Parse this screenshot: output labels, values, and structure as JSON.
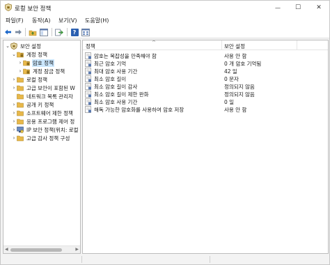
{
  "window": {
    "title": "로컬 보안 정책",
    "minimize_glyph": "—",
    "maximize_glyph": "☐",
    "close_glyph": "✕"
  },
  "menu": [
    {
      "label": "파일(F)"
    },
    {
      "label": "동작(A)"
    },
    {
      "label": "보기(V)"
    },
    {
      "label": "도움말(H)"
    }
  ],
  "toolbar": {
    "icons": [
      "back-arrow-icon",
      "forward-arrow-icon",
      "folder-up-icon",
      "show-hide-tree-icon",
      "export-list-icon",
      "help-icon",
      "properties-view-icon"
    ],
    "help_glyph": "?"
  },
  "tree": {
    "nodes": [
      {
        "label": "보안 설정",
        "expanded": true,
        "level": 0,
        "icon": "security-settings-icon"
      },
      {
        "label": "계정 정책",
        "expanded": true,
        "level": 1,
        "icon": "folder-icon"
      },
      {
        "label": "암호 정책",
        "expanded": false,
        "level": 2,
        "icon": "folder-icon",
        "selected": true
      },
      {
        "label": "계정 잠금 정책",
        "expanded": false,
        "level": 2,
        "icon": "folder-icon"
      },
      {
        "label": "로컬 정책",
        "expanded": false,
        "level": 1,
        "icon": "folder-icon"
      },
      {
        "label": "고급 보안이 포함된 W",
        "expanded": false,
        "level": 1,
        "icon": "folder-icon"
      },
      {
        "label": "네트워크 목록 관리자",
        "expanded": false,
        "level": 1,
        "icon": "folder-icon",
        "no_arrow": true
      },
      {
        "label": "공개 키 정책",
        "expanded": false,
        "level": 1,
        "icon": "folder-icon"
      },
      {
        "label": "소프트웨어 제한 정책",
        "expanded": false,
        "level": 1,
        "icon": "folder-icon"
      },
      {
        "label": "응용 프로그램 제어 정",
        "expanded": false,
        "level": 1,
        "icon": "folder-icon"
      },
      {
        "label": "IP 보안 정책(위치: 로컬",
        "expanded": false,
        "level": 1,
        "icon": "ip-security-icon"
      },
      {
        "label": "고급 감사 정책 구성",
        "expanded": false,
        "level": 1,
        "icon": "folder-icon"
      }
    ]
  },
  "list": {
    "columns": [
      "정책",
      "보안 설정"
    ],
    "rows": [
      {
        "policy": "암호는 복잡성을 만족해야 함",
        "setting": "사용 안 함"
      },
      {
        "policy": "최근 암호 기억",
        "setting": "0 개 암호 기억됨"
      },
      {
        "policy": "최대 암호 사용 기간",
        "setting": "42 일"
      },
      {
        "policy": "최소 암호 길이",
        "setting": "0 문자"
      },
      {
        "policy": "최소 암호 길이 감사",
        "setting": "정의되지 않음"
      },
      {
        "policy": "최소 암호 길이 제한 완화",
        "setting": "정의되지 않음"
      },
      {
        "policy": "최소 암호 사용 기간",
        "setting": "0 일"
      },
      {
        "policy": "해독 가능한 암호화를 사용하여 암호 저장",
        "setting": "사용 안 함"
      }
    ]
  },
  "colors": {
    "selection": "#cce8ff",
    "folder": "#e8b84a",
    "accent": "#1a66c9"
  }
}
